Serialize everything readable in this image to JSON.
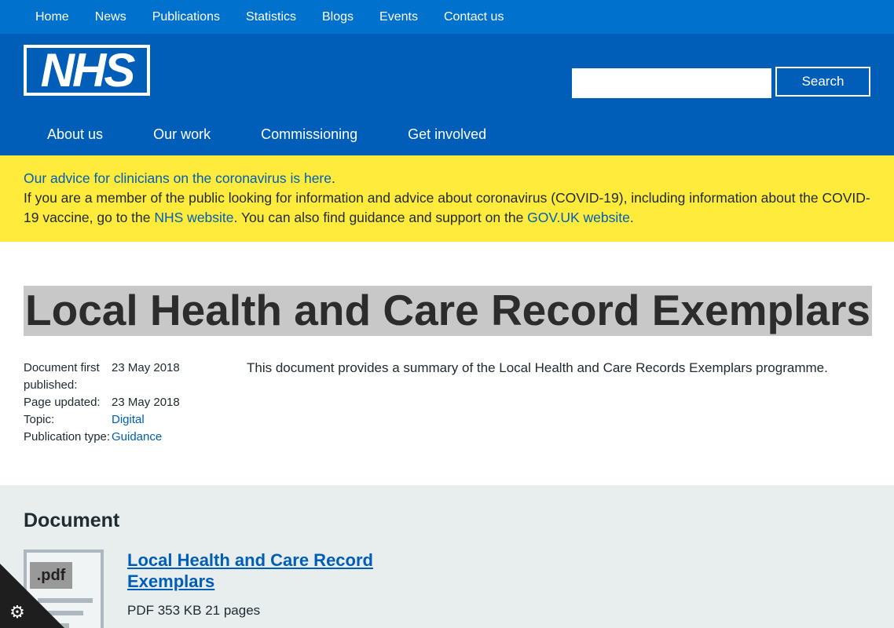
{
  "topnav": [
    "Home",
    "News",
    "Publications",
    "Statistics",
    "Blogs",
    "Events",
    "Contact us"
  ],
  "header": {
    "logo_text": "NHS",
    "search_label": "Search",
    "search_value": "",
    "mainnav": [
      "About us",
      "Our work",
      "Commissioning",
      "Get involved"
    ]
  },
  "alert": {
    "link1": "Our advice for clinicians on the coronavirus is here",
    "link1_tail": ".",
    "text1": "If you are a member of the public looking for information and advice about coronavirus (COVID-19), including information about the COVID-19 vaccine, go to the ",
    "link2": "NHS website",
    "text2": ". You can also find guidance and support on the ",
    "link3": "GOV.UK website",
    "text3": "."
  },
  "page": {
    "title": "Local Health and Care Record Exemplars",
    "summary": "This document provides a summary of the Local Health and Care Records Exemplars programme.",
    "meta": [
      {
        "key": "Document first published:",
        "value": "23 May 2018",
        "link": false
      },
      {
        "key": "Page updated:",
        "value": "23 May 2018",
        "link": false
      },
      {
        "key": "Topic:",
        "value": "Digital",
        "link": true
      },
      {
        "key": "Publication type:",
        "value": "Guidance",
        "link": true
      }
    ]
  },
  "documents": {
    "heading": "Document",
    "items": [
      {
        "title": "Local Health and Care Record Exemplars",
        "meta": "PDF 353 KB 21 pages",
        "thumb_label": ".pdf"
      }
    ]
  },
  "cookie": {
    "icon": "gear-icon"
  }
}
